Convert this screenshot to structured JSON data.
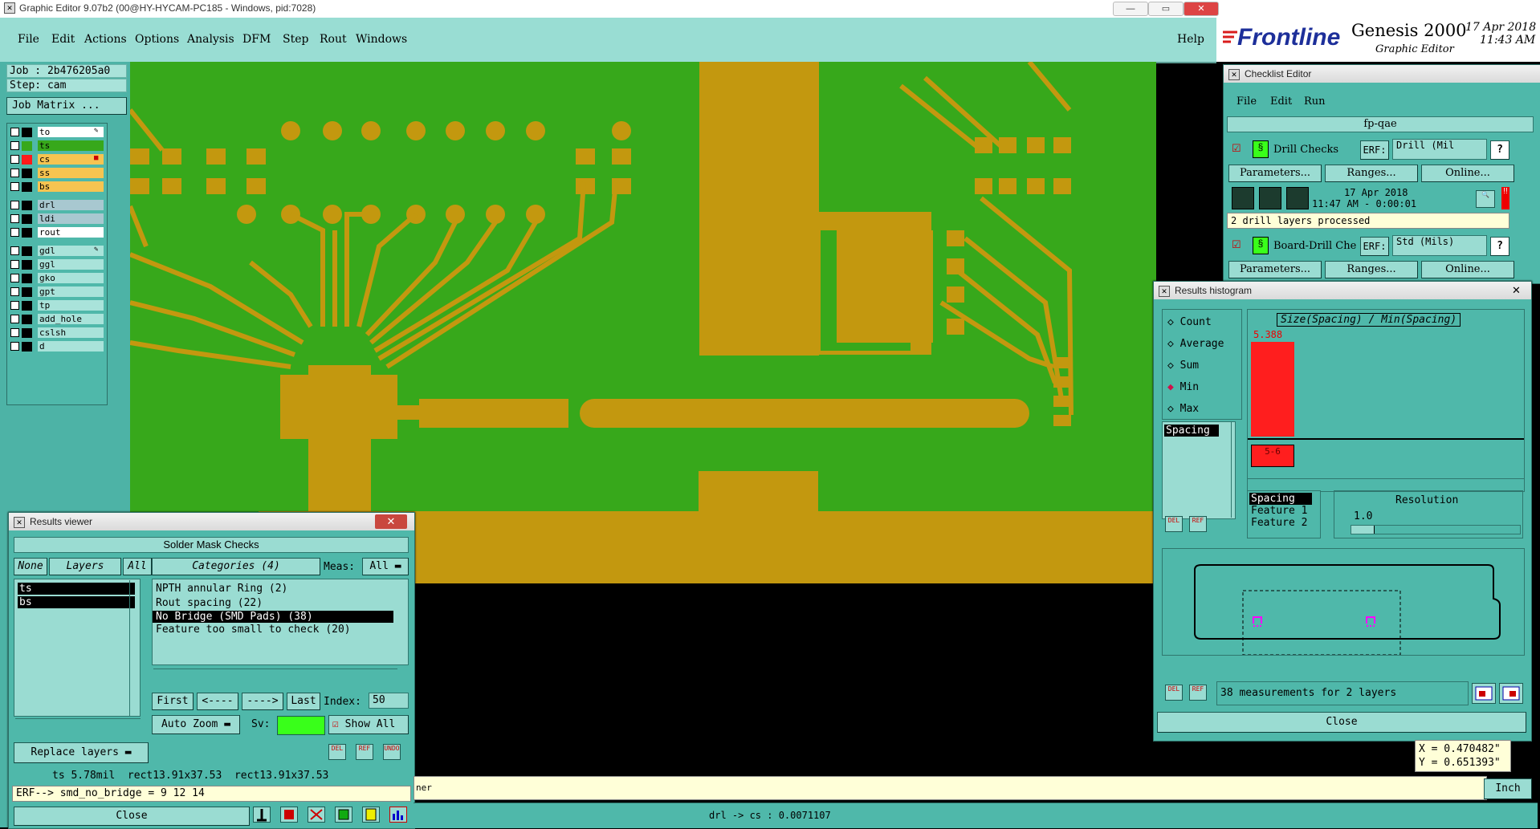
{
  "window_title": "Graphic Editor 9.07b2 (00@HY-HYCAM-PC185 - Windows, pid:7028)",
  "menu": [
    "File",
    "Edit",
    "Actions",
    "Options",
    "Analysis",
    "DFM",
    "Step",
    "Rout",
    "Windows"
  ],
  "help_label": "Help",
  "brand": {
    "logo": "Frontline",
    "product": "Genesis 2000",
    "subtitle": "Graphic Editor",
    "date": "17 Apr 2018",
    "time": "11:43 AM"
  },
  "job": "Job : 2b476205a0",
  "step": "Step: cam",
  "job_matrix_button": "Job Matrix ...",
  "layers": [
    {
      "name": "to",
      "color": "#000000",
      "bg": "#ffffff",
      "flag": "✎"
    },
    {
      "name": "ts",
      "color": "#37a81b",
      "bg": "#37a81b",
      "flag": ""
    },
    {
      "name": "cs",
      "color": "#ff1a1a",
      "bg": "#f6c451",
      "flag": "■"
    },
    {
      "name": "ss",
      "color": "#000000",
      "bg": "#f6c451",
      "flag": ""
    },
    {
      "name": "bs",
      "color": "#000000",
      "bg": "#f6c451",
      "flag": ""
    },
    {
      "name": "drl",
      "color": "#000000",
      "bg": "#a8c8d0",
      "flag": ""
    },
    {
      "name": "ldi",
      "color": "#000000",
      "bg": "#a8c8d0",
      "flag": ""
    },
    {
      "name": "rout",
      "color": "#000000",
      "bg": "#ffffff",
      "flag": ""
    },
    {
      "name": "gdl",
      "color": "#000000",
      "bg": "#a9e3da",
      "flag": "✎"
    },
    {
      "name": "ggl",
      "color": "#000000",
      "bg": "#a9e3da",
      "flag": ""
    },
    {
      "name": "gko",
      "color": "#000000",
      "bg": "#a9e3da",
      "flag": ""
    },
    {
      "name": "gpt",
      "color": "#000000",
      "bg": "#a9e3da",
      "flag": ""
    },
    {
      "name": "tp",
      "color": "#000000",
      "bg": "#a9e3da",
      "flag": ""
    },
    {
      "name": "add_hole",
      "color": "#000000",
      "bg": "#a9e3da",
      "flag": ""
    },
    {
      "name": "cslsh",
      "color": "#000000",
      "bg": "#a9e3da",
      "flag": ""
    },
    {
      "name": "d",
      "color": "#000000",
      "bg": "#a9e3da",
      "flag": ""
    }
  ],
  "results_viewer": {
    "title": "Results viewer",
    "close_x": "✕",
    "header": "Solder Mask Checks",
    "none_label": "None",
    "layers_label": "Layers",
    "all_label": "All",
    "categories_label": "Categories (4)",
    "meas_label": "Meas:",
    "meas_value": "All",
    "layer_list": [
      "ts",
      "bs"
    ],
    "categories": [
      "NPTH annular Ring (2)",
      "Rout spacing (22)",
      "No Bridge (SMD Pads) (38)",
      "Feature too small to check (20)"
    ],
    "first": "First",
    "prev": "<----",
    "next": "---->",
    "last": "Last",
    "index_label": "Index:",
    "index_value": "50",
    "auto_zoom": "Auto Zoom",
    "sv_label": "Sv:",
    "show_all": "Show All",
    "replace_layers": "Replace layers",
    "del": "DEL",
    "ref": "REF",
    "undo": "UNDO",
    "info_line": "ts 5.78mil  rect13.91x37.53  rect13.91x37.53",
    "erf_line": "ERF--> smd_no_bridge = 9 12 14",
    "close": "Close"
  },
  "checklist_editor": {
    "title": "Checklist Editor",
    "menu": [
      "File",
      "Edit",
      "Run"
    ],
    "name": "fp-qae",
    "checks": [
      {
        "label": "Drill Checks",
        "erf": "ERF:",
        "erf_value": "Drill (Mil",
        "params": "Parameters...",
        "ranges": "Ranges...",
        "online": "Online...",
        "date": "17 Apr 2018",
        "time": "11:47 AM - 0:00:01",
        "status": "2 drill layers processed"
      },
      {
        "label": "Board-Drill Che",
        "erf": "ERF:",
        "erf_value": "Std (Mils)",
        "params": "Parameters...",
        "ranges": "Ranges...",
        "online": "Online..."
      }
    ],
    "help": "?"
  },
  "histogram": {
    "title": "Results histogram",
    "modes": [
      "Count",
      "Average",
      "Sum",
      "Min",
      "Max"
    ],
    "selected_mode": "Min",
    "chart_title": "Size(Spacing) / Min(Spacing)",
    "bar_value": "5.388",
    "bin_label": "5-6",
    "list_item": "Spacing",
    "features": [
      "Spacing",
      "Feature 1",
      "Feature 2"
    ],
    "resolution_label": "Resolution",
    "resolution_value": "1.0",
    "measurements": "38 measurements for 2 layers",
    "del": "DEL",
    "ref": "REF",
    "close": "Close",
    "close_x": "✕"
  },
  "coords": {
    "x": "X = 0.470482\"",
    "y": "Y = 0.651393\""
  },
  "units": "Inch",
  "bottom_status": "drl -> cs : 0.0071107",
  "bottom_fragment": "ner"
}
